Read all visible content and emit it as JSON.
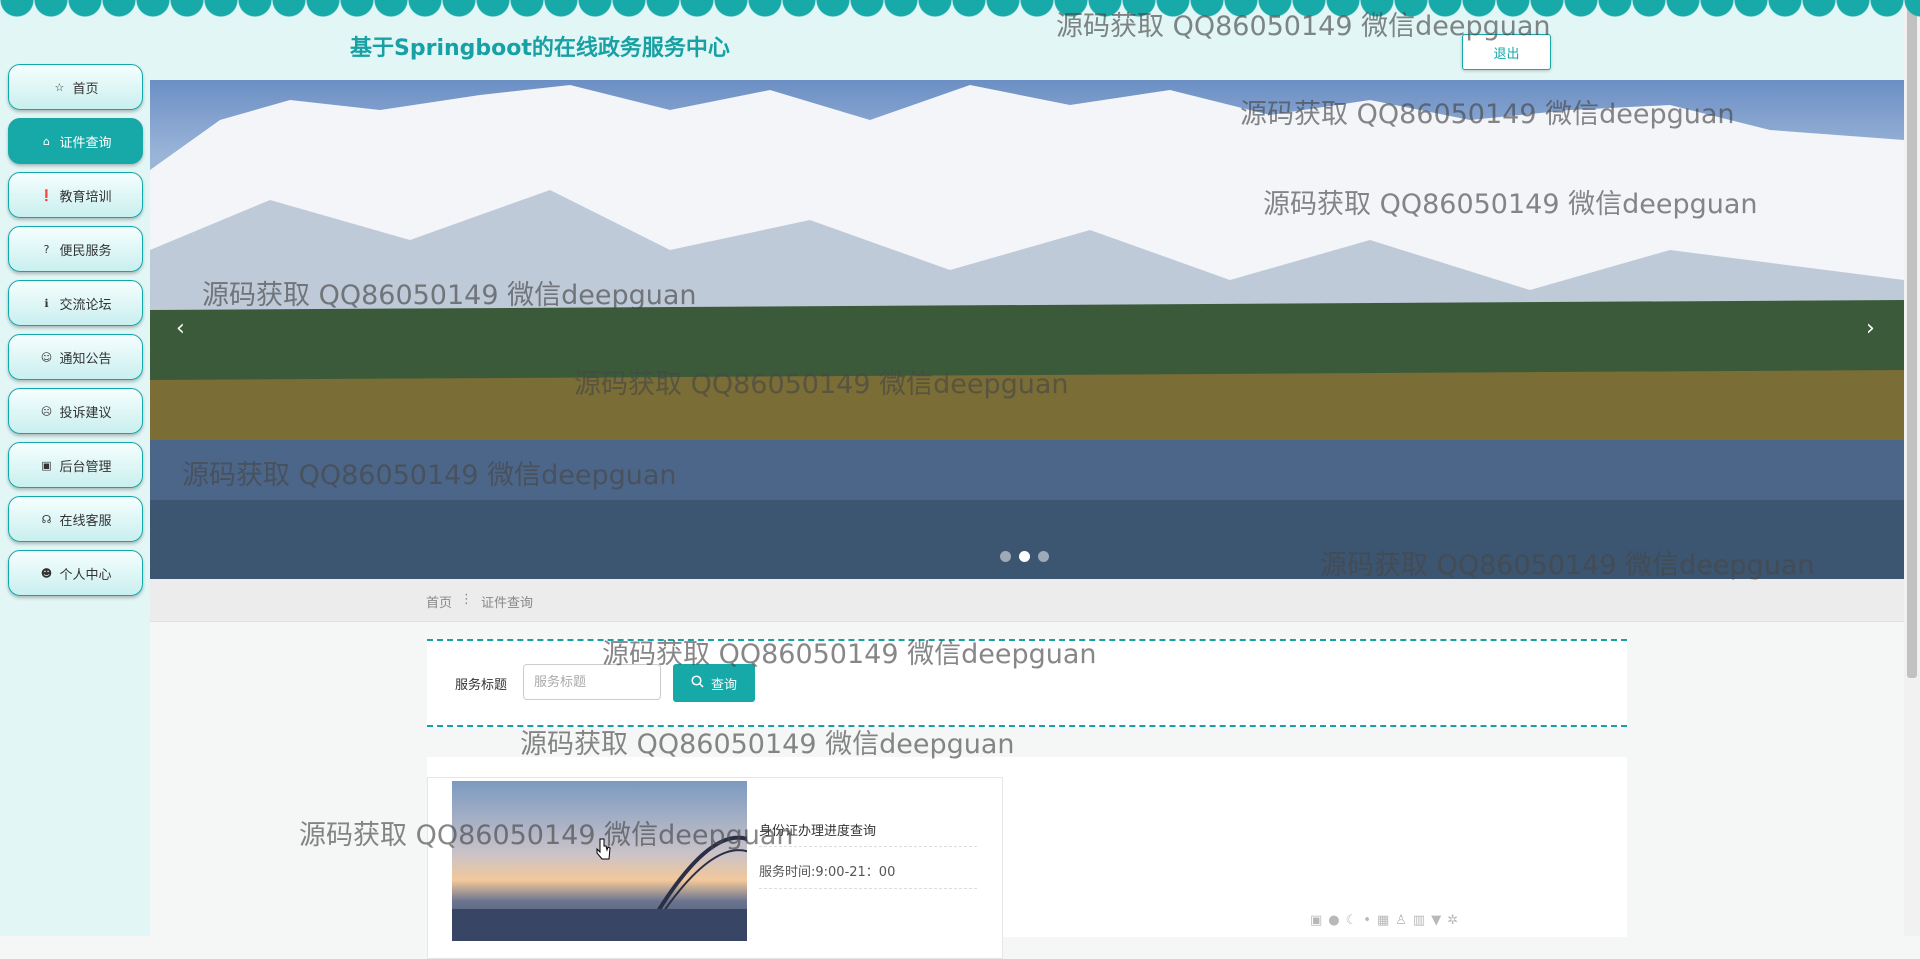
{
  "header": {
    "site_title": "基于Springboot的在线政务服务中心",
    "logout_label": "退出"
  },
  "sidebar": {
    "items": [
      {
        "label": "首页",
        "icon": "star-icon",
        "active": false
      },
      {
        "label": "证件查询",
        "icon": "home-icon",
        "active": true
      },
      {
        "label": "教育培训",
        "icon": "exclamation-icon",
        "active": false
      },
      {
        "label": "便民服务",
        "icon": "question-icon",
        "active": false
      },
      {
        "label": "交流论坛",
        "icon": "info-icon",
        "active": false
      },
      {
        "label": "通知公告",
        "icon": "smile-icon",
        "active": false
      },
      {
        "label": "投诉建议",
        "icon": "face-icon",
        "active": false
      },
      {
        "label": "后台管理",
        "icon": "briefcase-icon",
        "active": false
      },
      {
        "label": "在线客服",
        "icon": "headset-icon",
        "active": false
      },
      {
        "label": "个人中心",
        "icon": "user-icon",
        "active": false
      }
    ]
  },
  "banner": {
    "prev_arrow": "‹",
    "next_arrow": "›"
  },
  "breadcrumb": {
    "home": "首页",
    "separator": "⋮",
    "current": "证件查询"
  },
  "search": {
    "label": "服务标题",
    "placeholder": "服务标题",
    "value": "",
    "button_label": "查询"
  },
  "listing": [
    {
      "title": "身份证办理进度查询",
      "time": "服务时间:9:00-21：00"
    }
  ],
  "watermark_text": "源码获取 QQ86050149 微信deepguan",
  "colors": {
    "accent": "#17a8a8",
    "sidebar_bg": "#e2f6f6"
  }
}
